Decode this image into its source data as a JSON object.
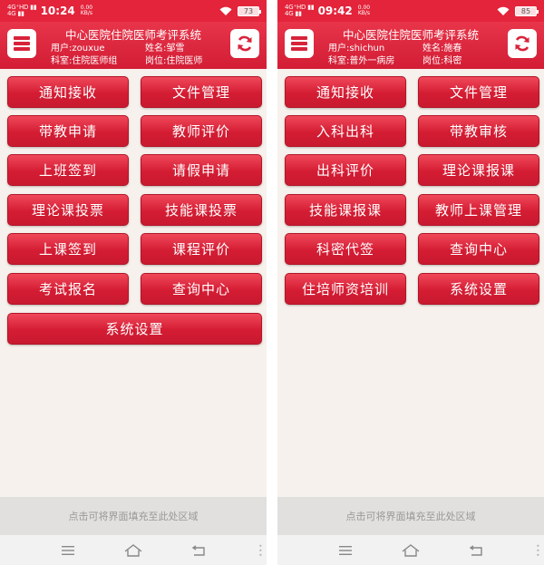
{
  "screens": [
    {
      "status": {
        "signal": [
          "4G⁺HD ▮▮",
          "4G ▮▮"
        ],
        "time": "10:24",
        "speed_value": "0.00",
        "speed_unit": "KB/s",
        "battery": "73"
      },
      "header": {
        "title": "中心医院住院医师考评系统",
        "user": "用户:zouxue",
        "name": "姓名:邹雪",
        "dept": "科室:住院医师组",
        "post": "岗位:住院医师"
      },
      "buttons": [
        "通知接收",
        "文件管理",
        "带教申请",
        "教师评价",
        "上班签到",
        "请假申请",
        "理论课投票",
        "技能课投票",
        "上课签到",
        "课程评价",
        "考试报名",
        "查询中心",
        "系统设置"
      ],
      "fill_hint": "点击可将界面填充至此处区域"
    },
    {
      "status": {
        "signal": [
          "4G⁺HD ▮▮",
          "4G ▮▮"
        ],
        "time": "09:42",
        "speed_value": "0.00",
        "speed_unit": "KB/s",
        "battery": "85"
      },
      "header": {
        "title": "中心医院住院医师考评系统",
        "user": "用户:shichun",
        "name": "姓名:施春",
        "dept": "科室:普外一病房",
        "post": "岗位:科密"
      },
      "buttons": [
        "通知接收",
        "文件管理",
        "入科出科",
        "带教审核",
        "出科评价",
        "理论课报课",
        "技能课报课",
        "教师上课管理",
        "科密代签",
        "查询中心",
        "住培师资培训",
        "系统设置"
      ],
      "fill_hint": "点击可将界面填充至此处区域"
    }
  ],
  "icons": {
    "menu": "hamburger-menu-icon",
    "refresh": "refresh-icon",
    "nav": [
      "menu-lines-icon",
      "home-icon",
      "back-icon"
    ]
  },
  "colors": {
    "accent": "#d8233b",
    "header_bg": "#e3243b",
    "body_bg": "#f6f1ec"
  }
}
